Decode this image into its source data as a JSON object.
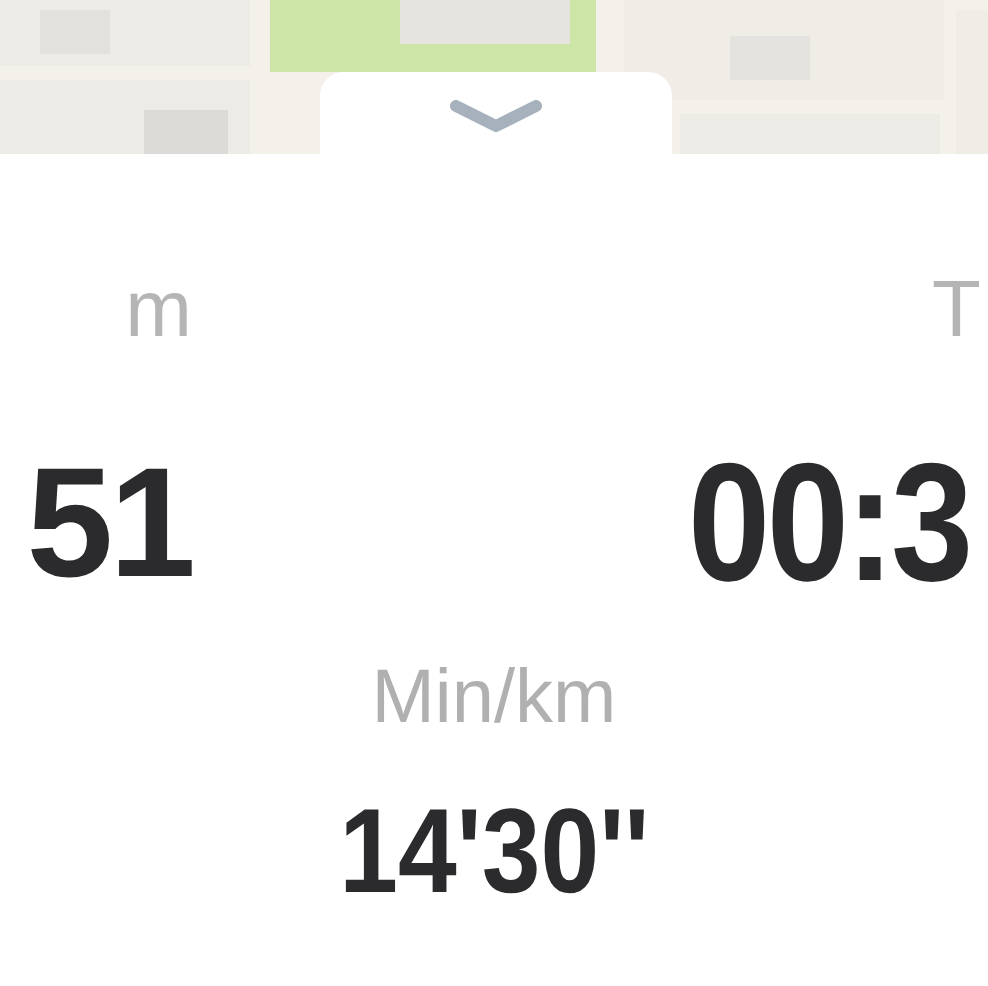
{
  "handle": {
    "expanded": true
  },
  "stats": [
    {
      "label": "m",
      "value": "51"
    },
    {
      "label": "T",
      "value": "00:3"
    }
  ],
  "pace": {
    "label": "Min/km",
    "value": "14'30''"
  }
}
